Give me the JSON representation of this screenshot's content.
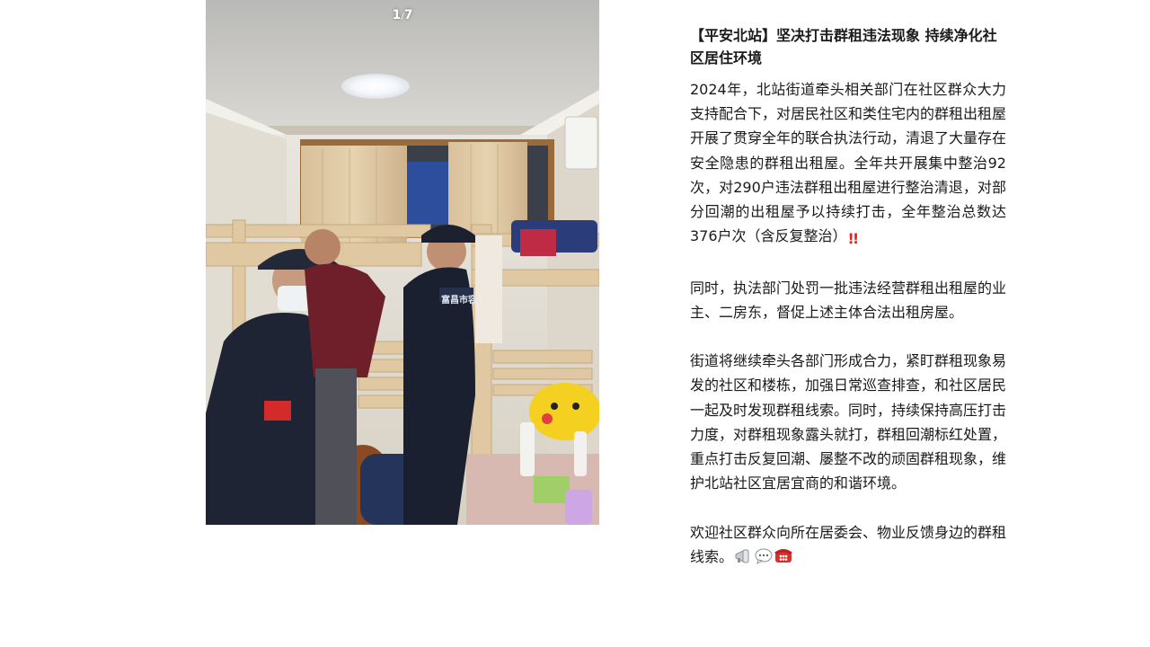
{
  "gallery": {
    "counter_current": "1",
    "counter_separator": "/",
    "counter_total": "7",
    "photo_badge_text": "富昌市容"
  },
  "post": {
    "title": "【平安北站】坚决打击群租违法现象 持续净化社区居住环境",
    "paragraph_1": "2024年，北站街道牵头相关部门在社区群众大力支持配合下，对居民社区和类住宅内的群租出租屋开展了贯穿全年的联合执法行动，清退了大量存在安全隐患的群租出租屋。全年共开展集中整治92次，对290户违法群租出租屋进行整治清退，对部分回潮的出租屋予以持续打击，全年整治总数达376户次（含反复整治）",
    "paragraph_1_emoji": "double-exclamation-icon",
    "paragraph_2": "同时，执法部门处罚一批违法经营群租出租屋的业主、二房东，督促上述主体合法出租房屋。",
    "paragraph_3": "街道将继续牵头各部门形成合力，紧盯群租现象易发的社区和楼栋，加强日常巡查排查，和社区居民一起及时发现群租线索。同时，持续保持高压打击力度，对群租现象露头就打，群租回潮标红处置，重点打击反复回潮、屡整不改的顽固群租现象，维护北站社区宜居宜商的和谐环境。",
    "paragraph_4": "欢迎社区群众向所在居委会、物业反馈身边的群租线索。",
    "paragraph_4_emojis": [
      "megaphone-icon",
      "speech-bubble-icon",
      "telephone-icon"
    ]
  },
  "colors": {
    "text": "#1a1a1a",
    "accent_red": "#e0271c",
    "background": "#ffffff"
  }
}
